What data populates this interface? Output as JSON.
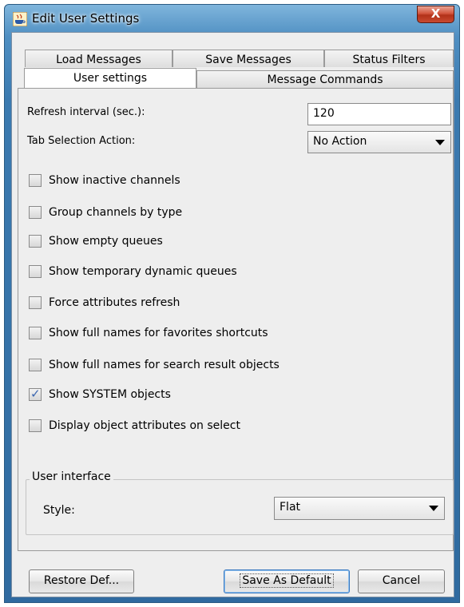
{
  "window": {
    "title": "Edit User Settings",
    "close_label": "X"
  },
  "tabs": {
    "row_back": [
      "Load Messages",
      "Save Messages",
      "Status Filters"
    ],
    "row_front": [
      "User settings",
      "Message Commands"
    ],
    "active": "User settings"
  },
  "settings": {
    "refresh_label": "Refresh interval (sec.):",
    "refresh_value": "120",
    "tab_action_label": "Tab Selection Action:",
    "tab_action_value": "No Action"
  },
  "checkboxes": [
    {
      "label": "Show inactive channels",
      "checked": false
    },
    {
      "label": "Group channels by type",
      "checked": false
    },
    {
      "label": "Show empty queues",
      "checked": false
    },
    {
      "label": "Show temporary dynamic queues",
      "checked": false
    },
    {
      "label": "Force attributes refresh",
      "checked": false
    },
    {
      "label": "Show full names for favorites shortcuts",
      "checked": false
    },
    {
      "label": "Show full names for search result objects",
      "checked": false
    },
    {
      "label": "Show SYSTEM objects",
      "checked": true
    },
    {
      "label": "Display object attributes on select",
      "checked": false
    }
  ],
  "ui_group": {
    "title": "User interface",
    "style_label": "Style:",
    "style_value": "Flat"
  },
  "buttons": {
    "restore": "Restore Def...",
    "save_default": "Save As Default",
    "cancel": "Cancel"
  },
  "colors": {
    "titlebar": "#4f8fc2",
    "close": "#c84a30",
    "check": "#3b66b0"
  }
}
